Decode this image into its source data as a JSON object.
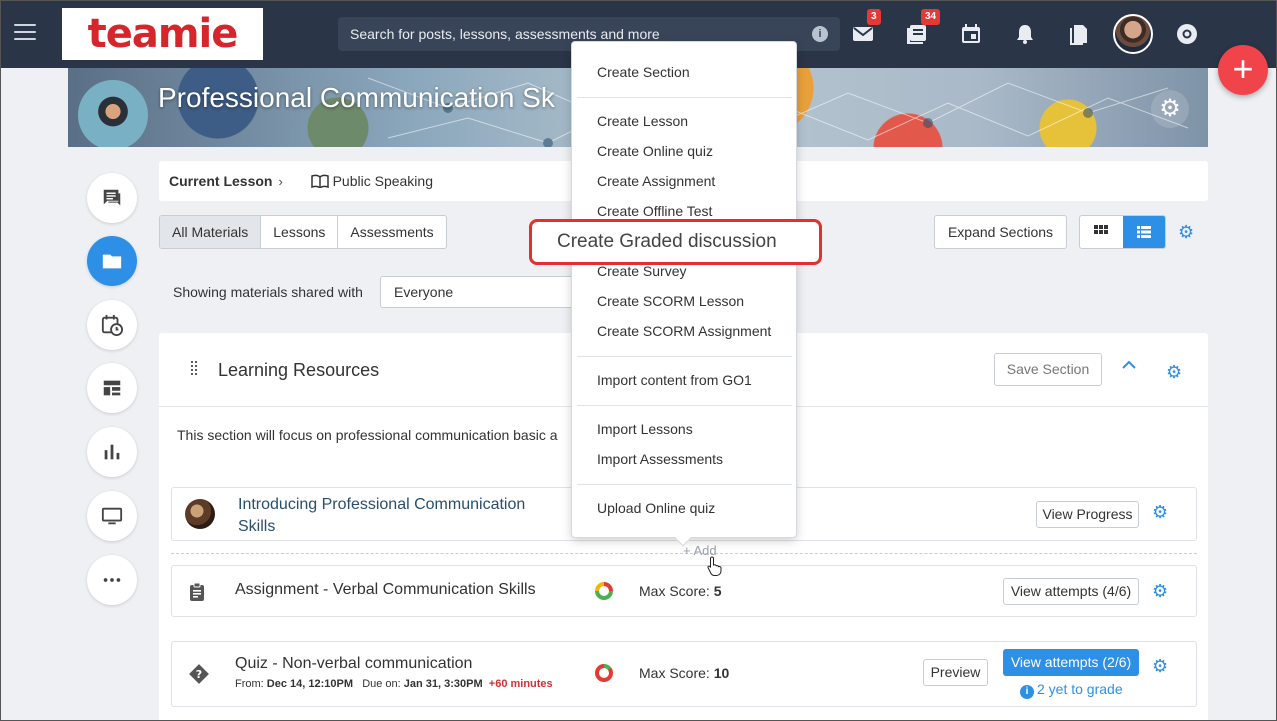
{
  "topbar": {
    "logo": "teamie",
    "search_placeholder": "Search for posts, lessons, assessments and more",
    "info_icon": "i",
    "mail_badge": "3",
    "news_badge": "34"
  },
  "fab": {
    "label": "+"
  },
  "banner": {
    "title": "Professional Communication Sk"
  },
  "breadcrumb": {
    "current_label": "Current Lesson",
    "lesson": "Public Speaking"
  },
  "filters": {
    "tabs": [
      "All Materials",
      "Lessons",
      "Assessments"
    ],
    "expand_sections": "Expand Sections",
    "shared_label": "Showing materials shared with",
    "shared_value": "Everyone"
  },
  "section": {
    "title": "Learning Resources",
    "save_button": "Save Section",
    "description": "This section will focus on professional communication basic a",
    "add_label": "+ Add",
    "items": [
      {
        "title_line1": "Introducing Professional Communication",
        "title_line2": "Skills",
        "action": "View Progress"
      },
      {
        "title": "Assignment - Verbal Communication Skills",
        "score_label": "Max Score:",
        "score_value": "5",
        "action": "View attempts (4/6)"
      },
      {
        "title": "Quiz - Non-verbal communication",
        "from_label": "From:",
        "from_value": "Dec 14, 12:10PM",
        "due_label": "Due on:",
        "due_value": "Jan 31, 3:30PM",
        "late": "+60 minutes",
        "score_label": "Max Score:",
        "score_value": "10",
        "preview": "Preview",
        "action": "View attempts (2/6)",
        "grade_note": "2 yet to grade"
      }
    ]
  },
  "add_menu": {
    "items": [
      "Create Section",
      "Create Lesson",
      "Create Online quiz",
      "Create Assignment",
      "Create Offline Test",
      "Create Graded discussion",
      "Create Survey",
      "Create SCORM Lesson",
      "Create SCORM Assignment",
      "Import content from GO1",
      "Import Lessons",
      "Import Assessments",
      "Upload Online quiz"
    ]
  },
  "colors": {
    "accent": "#2e8fe6",
    "topbar": "#2a3547",
    "brand": "#d6262c",
    "highlight": "#e0312e"
  }
}
